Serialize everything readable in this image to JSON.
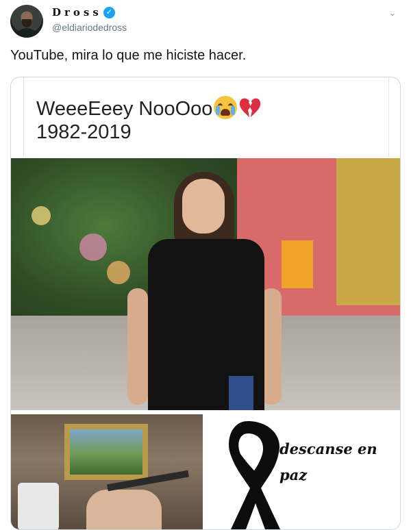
{
  "author": {
    "display_name": "Dross",
    "handle": "@eldiariodedross",
    "verified": true
  },
  "tweet": {
    "text": "YouTube, mira lo que me hiciste hacer."
  },
  "meme": {
    "title": "WeeeEeey NooOoo",
    "years": "1982-2019",
    "rip_line1": "descanse en",
    "rip_line2": "paz"
  },
  "colors": {
    "verified_blue": "#1da1f2",
    "handle_gray": "#657786",
    "card_border": "#ccd6dd"
  },
  "icons": [
    "verified-badge-icon",
    "chevron-down-icon",
    "crying-face-emoji",
    "broken-heart-emoji",
    "black-ribbon-icon"
  ]
}
